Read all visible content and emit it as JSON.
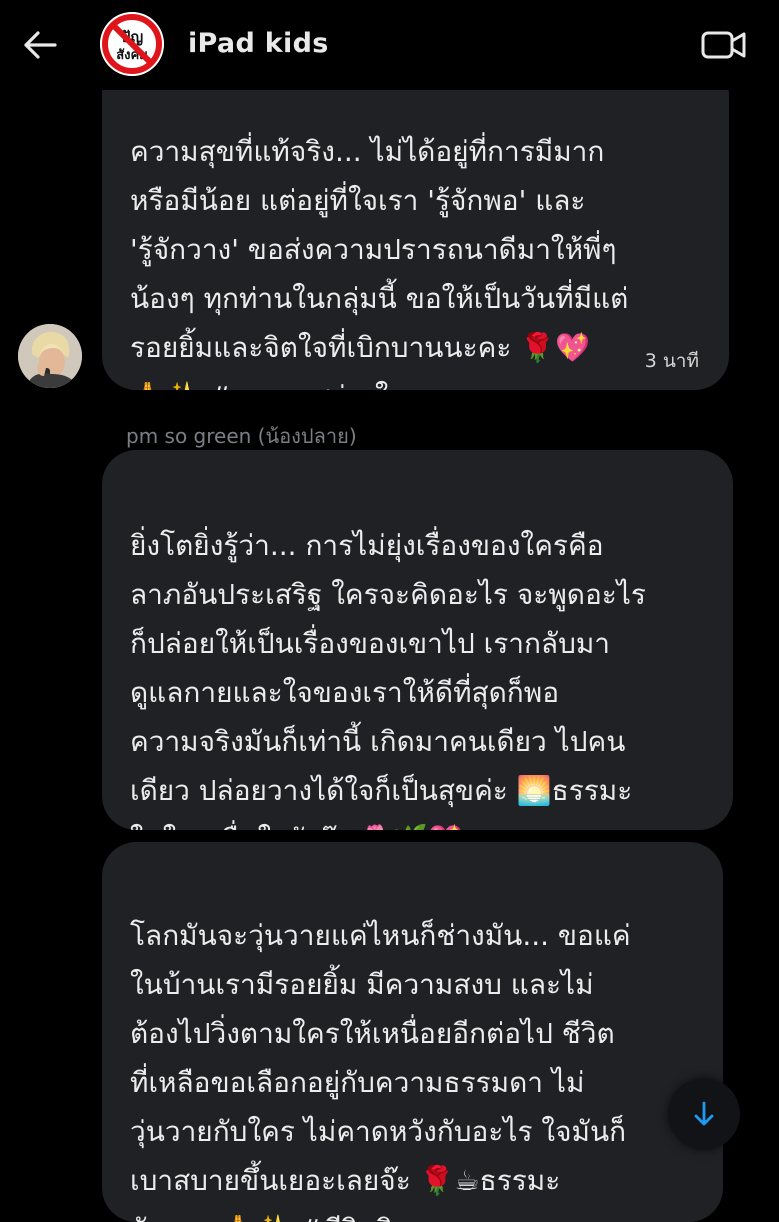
{
  "header": {
    "title": "iPad kids",
    "back_icon": "arrow-left-icon",
    "video_icon": "video-camera-icon",
    "avatar_text": "ปัญ สังคม"
  },
  "messages": [
    {
      "text": "ความสุขที่แท้จริง... ไม่ได้อยู่ที่การมีมาก\nหรือมีน้อย แต่อยู่ที่ใจเรา 'รู้จักพอ' และ\n'รู้จักวาง' ขอส่งความปรารถนาดีมาให้พี่ๆ\nน้องๆ ทุกท่านในกลุ่มนี้ ขอให้เป็นวันที่มีแต่\nรอยยิ้มและจิตใจที่เบิกบานนะคะ 🌹💖\n🙏✨ #ธรรมะสว่างใจ",
      "time": "3 นาที"
    },
    {
      "sender": "pm so green (น้องปลาย)",
      "text": "ยิ่งโตยิ่งรู้ว่า... การไม่ยุ่งเรื่องของใครคือ\nลาภอันประเสริฐ ใครจะคิดอะไร จะพูดอะไร\nก็ปล่อยให้เป็นเรื่องของเขาไป เรากลับมา\nดูแลกายและใจของเราให้ดีที่สุดก็พอ\nความจริงมันก็เท่านี้ เกิดมาคนเดียว ไปคน\nเดียว ปล่อยวางได้ใจก็เป็นสุขค่ะ 🌅ธรรมะ\nในใจ...ชื่นใจจังจ๊ะ 🌷🌿💖"
    },
    {
      "text": "โลกมันจะวุ่นวายแค่ไหนก็ช่างมัน... ขอแค่\nในบ้านเรามีรอยยิ้ม มีความสงบ และไม่\nต้องไปวิ่งตามใครให้เหนื่อยอีกต่อไป ชีวิต\nที่เหลือขอเลือกอยู่กับความธรรมดา ไม่\nวุ่นวายกับใคร ไม่คาดหวังกับอะไร ใจมันก็\nเบาสบายขึ้นเยอะเลยจ๊ะ 🌹☕ธรรมะ\nจัดสรร 🙏✨ #ชีวิตอิสระ"
    }
  ],
  "scroll_icon": "arrow-down-icon",
  "colors": {
    "background": "#000000",
    "bubble": "#1f2125",
    "text": "#ececec",
    "accent": "#1d9bf0",
    "muted": "#7b7f84"
  }
}
